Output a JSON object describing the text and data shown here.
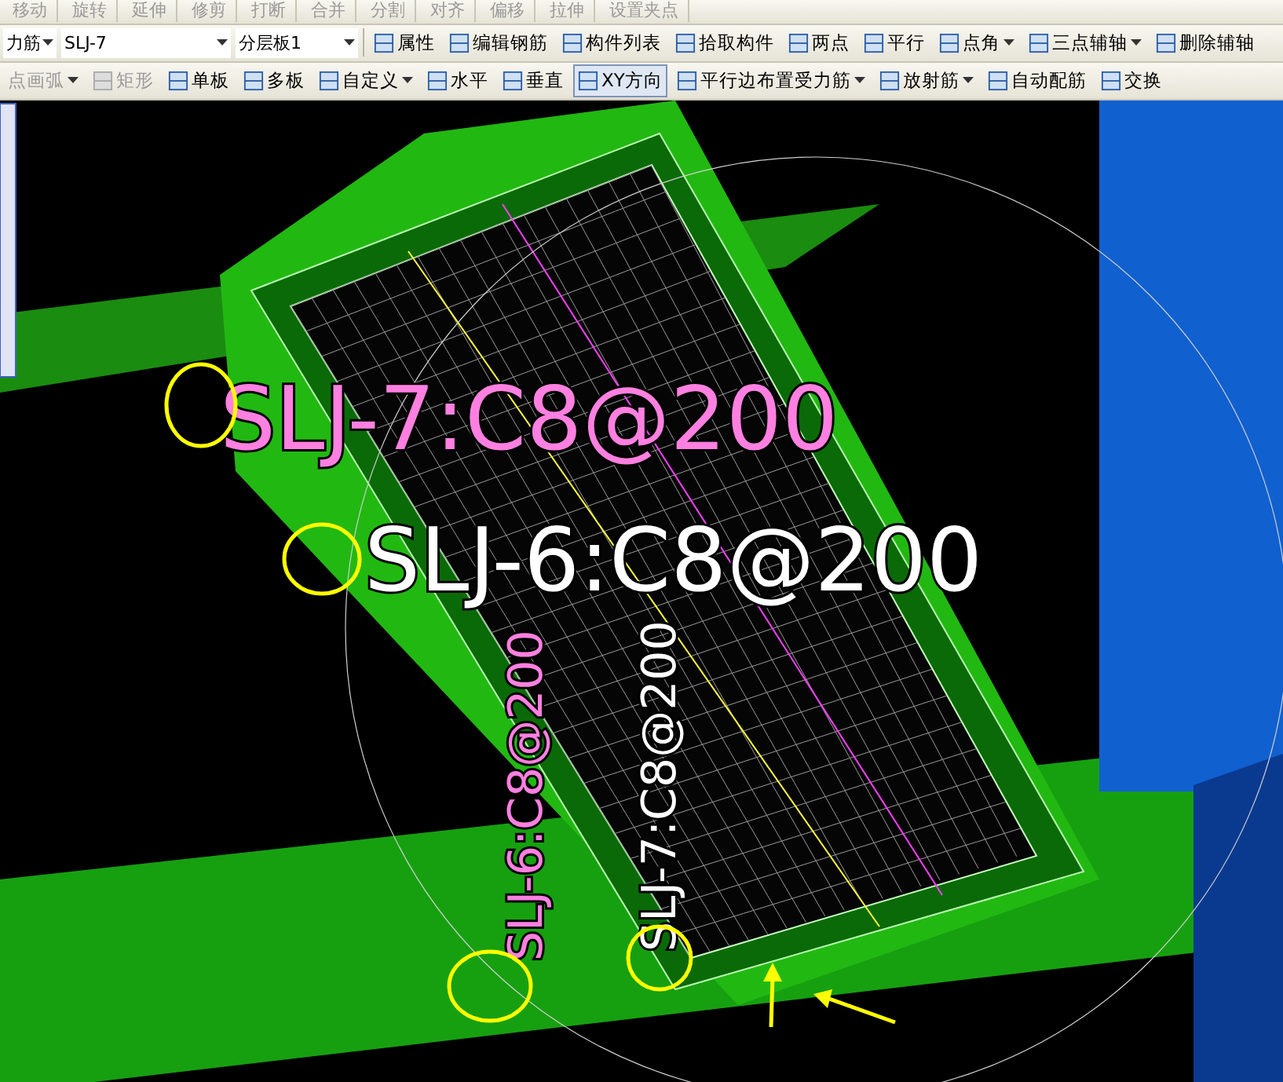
{
  "edit_toolbar": [
    {
      "label": "移动"
    },
    {
      "label": "旋转"
    },
    {
      "label": "延伸"
    },
    {
      "label": "修剪"
    },
    {
      "label": "打断"
    },
    {
      "label": "合并"
    },
    {
      "label": "分割"
    },
    {
      "label": "对齐"
    },
    {
      "label": "偏移"
    },
    {
      "label": "拉伸"
    },
    {
      "label": "设置夹点"
    }
  ],
  "component_toolbar": {
    "dropdowns": [
      {
        "value": "力筋"
      },
      {
        "value": "SLJ-7"
      },
      {
        "value": "分层板1"
      }
    ],
    "buttons": [
      {
        "label": "属性",
        "has_menu": false
      },
      {
        "label": "编辑钢筋",
        "has_menu": false
      },
      {
        "label": "构件列表",
        "has_menu": false
      },
      {
        "label": "拾取构件",
        "has_menu": false
      },
      {
        "label": "两点",
        "has_menu": false
      },
      {
        "label": "平行",
        "has_menu": false
      },
      {
        "label": "点角",
        "has_menu": true
      },
      {
        "label": "三点辅轴",
        "has_menu": true
      },
      {
        "label": "删除辅轴",
        "has_menu": false
      }
    ]
  },
  "draw_toolbar": {
    "items": [
      {
        "label": "点画弧",
        "has_menu": true,
        "disabled": true,
        "selected": false
      },
      {
        "label": "矩形",
        "has_menu": false,
        "disabled": true,
        "selected": false
      },
      {
        "label": "单板",
        "has_menu": false,
        "disabled": false,
        "selected": false
      },
      {
        "label": "多板",
        "has_menu": false,
        "disabled": false,
        "selected": false
      },
      {
        "label": "自定义",
        "has_menu": true,
        "disabled": false,
        "selected": false
      },
      {
        "label": "水平",
        "has_menu": false,
        "disabled": false,
        "selected": false
      },
      {
        "label": "垂直",
        "has_menu": false,
        "disabled": false,
        "selected": false
      },
      {
        "label": "XY方向",
        "has_menu": false,
        "disabled": false,
        "selected": true
      },
      {
        "label": "平行边布置受力筋",
        "has_menu": true,
        "disabled": false,
        "selected": false
      },
      {
        "label": "放射筋",
        "has_menu": true,
        "disabled": false,
        "selected": false
      },
      {
        "label": "自动配筋",
        "has_menu": false,
        "disabled": false,
        "selected": false
      },
      {
        "label": "交换",
        "has_menu": false,
        "disabled": false,
        "selected": false
      }
    ]
  },
  "viewport": {
    "labels": [
      {
        "text": "SLJ-7:C8@200",
        "kind": "horizontal"
      },
      {
        "text": "SLJ-6:C8@200",
        "kind": "horizontal"
      },
      {
        "text": "SLJ-6:C8@200",
        "kind": "vertical"
      },
      {
        "text": "SLJ-7:C8@200",
        "kind": "vertical"
      }
    ]
  }
}
